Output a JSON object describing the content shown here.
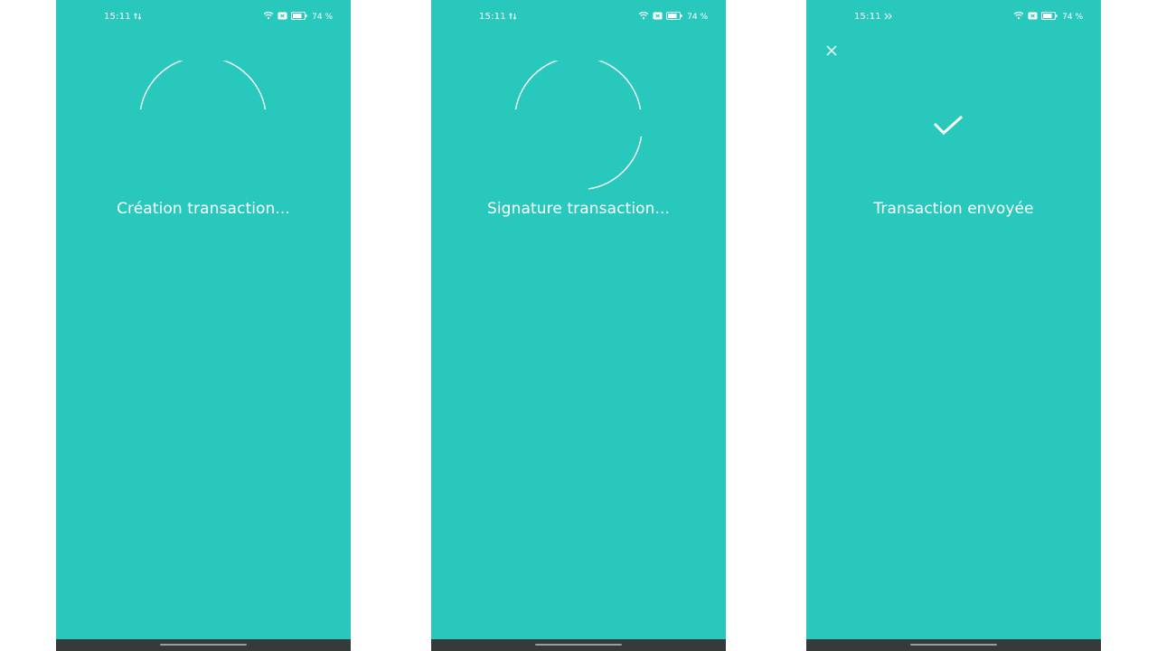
{
  "colors": {
    "screen_background": "#28c9bc",
    "foreground": "#ffffff",
    "nav_bar": "#363a3a",
    "home_indicator": "#9c9c9c"
  },
  "screens": [
    {
      "status_bar": {
        "time": "15:11",
        "battery": "74 %",
        "icons": [
          "network-activity-icon",
          "wifi-icon",
          "sim-icon",
          "battery-icon"
        ]
      },
      "state": "loading",
      "icon": "spinner-icon",
      "message": "Création transaction..."
    },
    {
      "status_bar": {
        "time": "15:11",
        "battery": "74 %",
        "icons": [
          "network-activity-icon",
          "wifi-icon",
          "sim-icon",
          "battery-icon"
        ]
      },
      "state": "loading",
      "icon": "spinner-icon",
      "message": "Signature transaction..."
    },
    {
      "status_bar": {
        "time": "15:11",
        "battery": "74 %",
        "icons": [
          "data-transfer-icon",
          "wifi-icon",
          "sim-icon",
          "battery-icon"
        ]
      },
      "state": "success",
      "icon": "checkmark-icon",
      "close_icon": "close-icon",
      "message": "Transaction envoyée"
    }
  ]
}
